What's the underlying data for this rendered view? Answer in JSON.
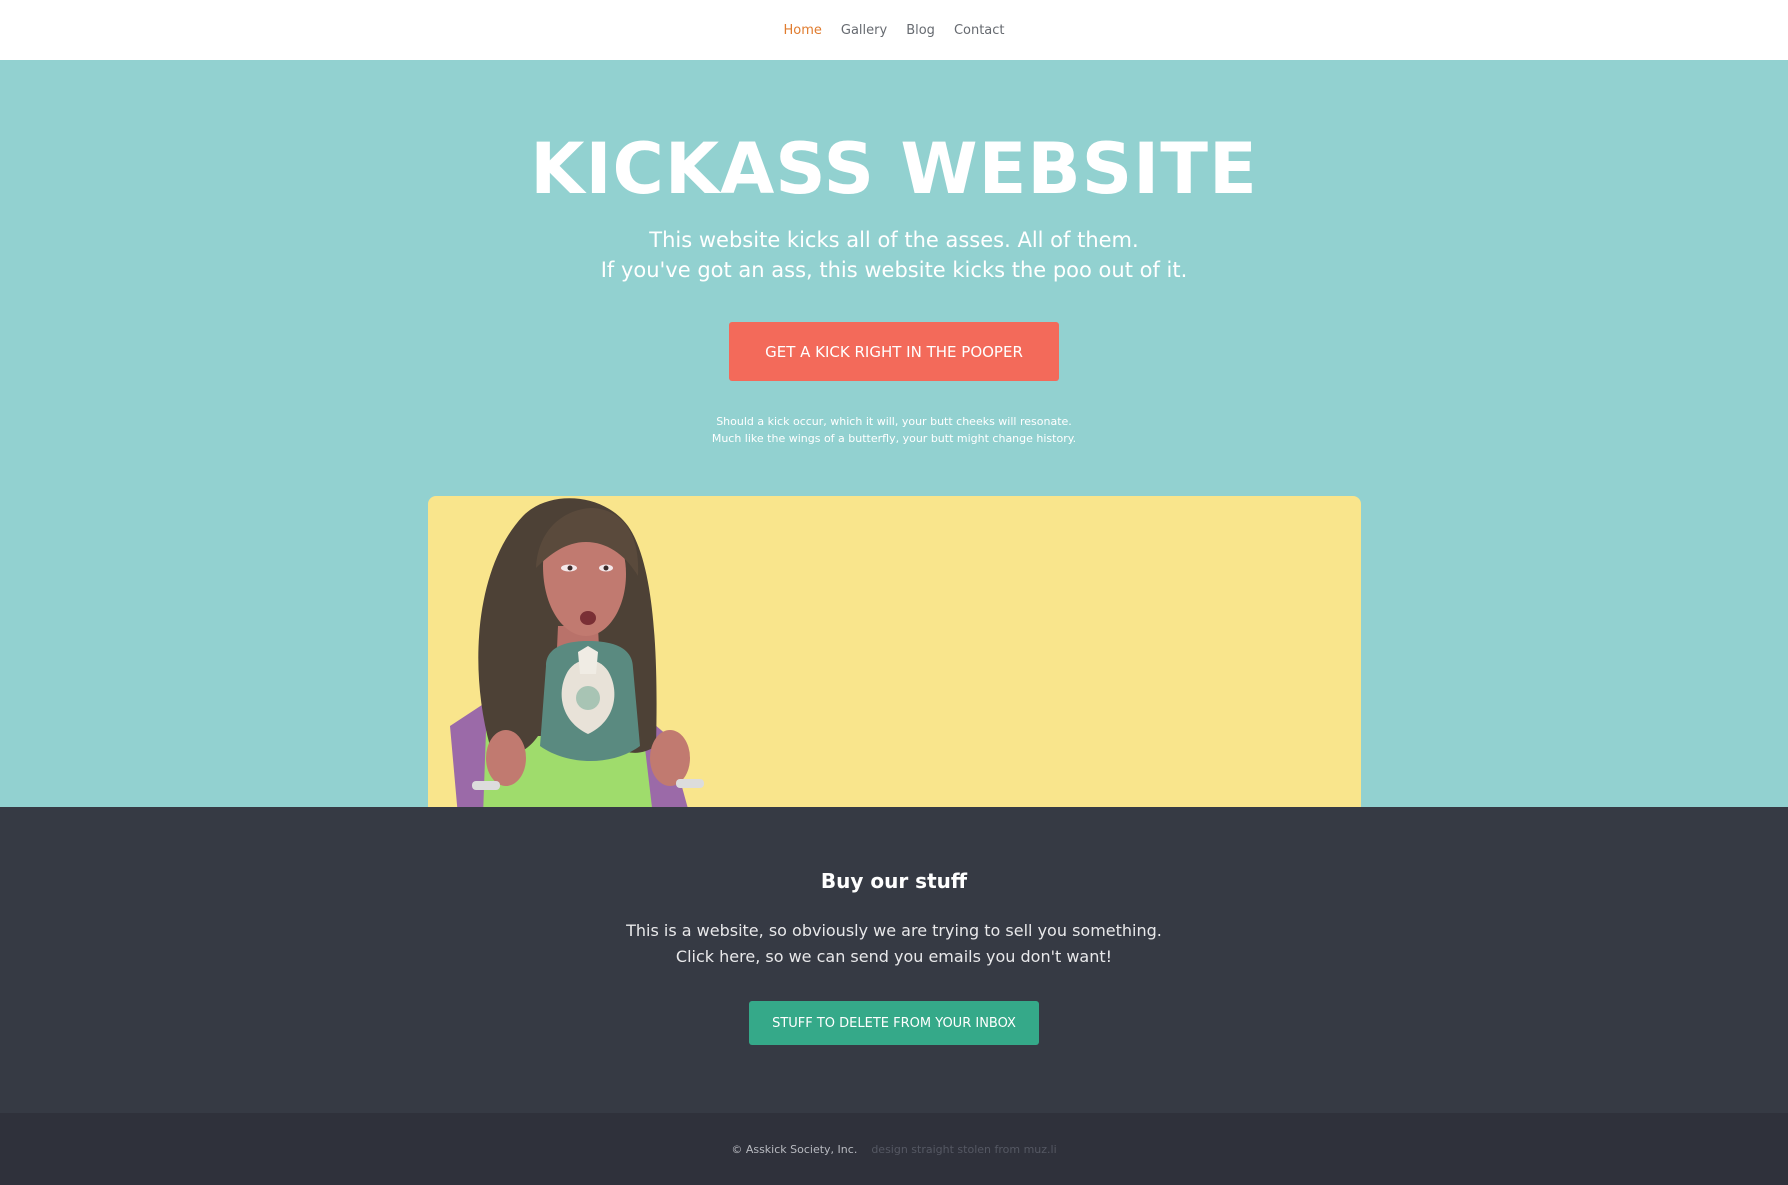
{
  "nav": {
    "items": [
      {
        "label": "Home",
        "active": true
      },
      {
        "label": "Gallery",
        "active": false
      },
      {
        "label": "Blog",
        "active": false
      },
      {
        "label": "Contact",
        "active": false
      }
    ]
  },
  "hero": {
    "title": "KICKASS WEBSITE",
    "subtitle_line1": "This website kicks all of the asses. All of them.",
    "subtitle_line2": "If you've got an ass, this website kicks the poo out of it.",
    "cta_label": "GET A KICK RIGHT IN THE POOPER",
    "note_line1": "Should a kick occur, which it will, your butt cheeks will resonate.",
    "note_line2": "Much like the wings of a butterfly, your butt might change history.",
    "colors": {
      "background": "#92d1d0",
      "cta": "#f36a5a",
      "showcase": "#f9e58c"
    }
  },
  "buy": {
    "title": "Buy our stuff",
    "text_line1": "This is a website, so obviously we are trying to sell you something.",
    "text_line2": "Click here, so we can send you emails you don't want!",
    "button_label": "STUFF TO DELETE FROM YOUR INBOX",
    "colors": {
      "background": "#363a44",
      "button": "#35a989"
    }
  },
  "footer": {
    "copyright": "© Asskick Society, Inc.",
    "credit": "design straight stolen from muz.li"
  }
}
